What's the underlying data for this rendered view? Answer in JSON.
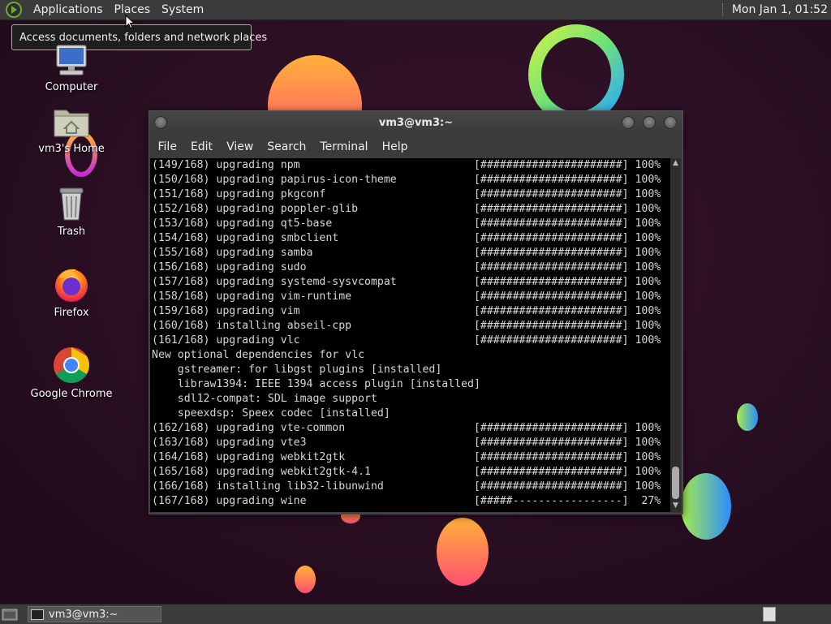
{
  "panel": {
    "menus": [
      "Applications",
      "Places",
      "System"
    ],
    "clock": "Mon Jan 1, 01:52"
  },
  "tooltip": "Access documents, folders and network places",
  "desktop_icons": [
    {
      "label": "Computer",
      "icon": "computer-icon"
    },
    {
      "label": "vm3's Home",
      "icon": "home-folder-icon"
    },
    {
      "label": "Trash",
      "icon": "trash-icon"
    },
    {
      "label": "Firefox",
      "icon": "firefox-icon"
    },
    {
      "label": "Google Chrome",
      "icon": "chrome-icon"
    }
  ],
  "window": {
    "title": "vm3@vm3:~",
    "menus": [
      "File",
      "Edit",
      "View",
      "Search",
      "Terminal",
      "Help"
    ]
  },
  "terminal_lines": [
    "(149/168) upgrading npm                           [######################] 100%",
    "(150/168) upgrading papirus-icon-theme            [######################] 100%",
    "(151/168) upgrading pkgconf                       [######################] 100%",
    "(152/168) upgrading poppler-glib                  [######################] 100%",
    "(153/168) upgrading qt5-base                      [######################] 100%",
    "(154/168) upgrading smbclient                     [######################] 100%",
    "(155/168) upgrading samba                         [######################] 100%",
    "(156/168) upgrading sudo                          [######################] 100%",
    "(157/168) upgrading systemd-sysvcompat            [######################] 100%",
    "(158/168) upgrading vim-runtime                   [######################] 100%",
    "(159/168) upgrading vim                           [######################] 100%",
    "(160/168) installing abseil-cpp                   [######################] 100%",
    "(161/168) upgrading vlc                           [######################] 100%",
    "New optional dependencies for vlc",
    "    gstreamer: for libgst plugins [installed]",
    "    libraw1394: IEEE 1394 access plugin [installed]",
    "    sdl12-compat: SDL image support",
    "    speexdsp: Speex codec [installed]",
    "(162/168) upgrading vte-common                    [######################] 100%",
    "(163/168) upgrading vte3                          [######################] 100%",
    "(164/168) upgrading webkit2gtk                    [######################] 100%",
    "(165/168) upgrading webkit2gtk-4.1                [######################] 100%",
    "(166/168) installing lib32-libunwind              [######################] 100%",
    "(167/168) upgrading wine                          [#####-----------------]  27%"
  ],
  "taskbar": {
    "task": "vm3@vm3:~"
  },
  "colors": {
    "wallpaper": "#2a0f22",
    "panel": "#3b3b3b",
    "terminal_bg": "#000000",
    "terminal_fg": "#d6d6d6"
  }
}
